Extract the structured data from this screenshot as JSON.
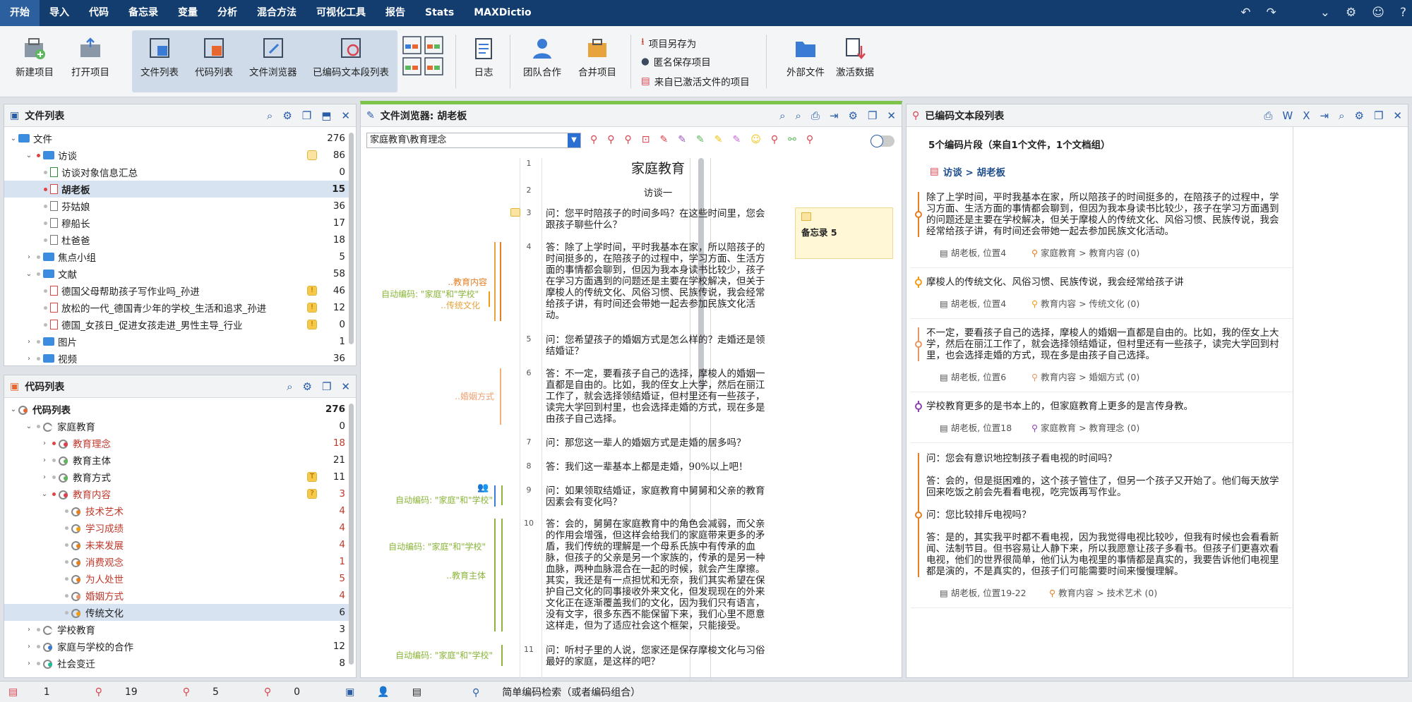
{
  "menu": [
    "开始",
    "导入",
    "代码",
    "备忘录",
    "变量",
    "分析",
    "混合方法",
    "可视化工具",
    "报告",
    "Stats",
    "MAXDictio"
  ],
  "ribbon": {
    "new_project": "新建项目",
    "open_project": "打开项目",
    "doc_list": "文件列表",
    "code_list": "代码列表",
    "doc_browser": "文件浏览器",
    "retrieved_segments": "已编码文本段列表",
    "logbook": "日志",
    "teamwork": "团队合作",
    "merge_projects": "合并项目",
    "save_as": "项目另存为",
    "save_anon": "匿名保存项目",
    "from_activated": "来自已激活文件的项目",
    "external_files": "外部文件",
    "activate_data": "激活数据"
  },
  "doc_panel": {
    "title": "文件列表",
    "rows": [
      {
        "label": "文件",
        "count": "276"
      },
      {
        "label": "访谈",
        "count": "86"
      },
      {
        "label": "访谈对象信息汇总",
        "count": "0"
      },
      {
        "label": "胡老板",
        "count": "15"
      },
      {
        "label": "芬姑娘",
        "count": "36"
      },
      {
        "label": "穆船长",
        "count": "17"
      },
      {
        "label": "杜爸爸",
        "count": "18"
      },
      {
        "label": "焦点小组",
        "count": "5"
      },
      {
        "label": "文献",
        "count": "58"
      },
      {
        "label": "德国父母帮助孩子写作业吗_孙进",
        "count": "46"
      },
      {
        "label": "放松的一代_德国青少年的学校_生活和追求_孙进",
        "count": "12"
      },
      {
        "label": "德国_女孩日_促进女孩走进_男性主导_行业",
        "count": "0"
      },
      {
        "label": "图片",
        "count": "1"
      },
      {
        "label": "视频",
        "count": "36"
      }
    ]
  },
  "code_panel": {
    "title": "代码列表",
    "rows": [
      {
        "label": "代码列表",
        "count": "276"
      },
      {
        "label": "家庭教育",
        "count": "0"
      },
      {
        "label": "教育理念",
        "count": "18"
      },
      {
        "label": "教育主体",
        "count": "21"
      },
      {
        "label": "教育方式",
        "count": "11"
      },
      {
        "label": "教育内容",
        "count": "3"
      },
      {
        "label": "技术艺术",
        "count": "4"
      },
      {
        "label": "学习成绩",
        "count": "4"
      },
      {
        "label": "未来发展",
        "count": "4"
      },
      {
        "label": "消费观念",
        "count": "1"
      },
      {
        "label": "为人处世",
        "count": "5"
      },
      {
        "label": "婚姻方式",
        "count": "4"
      },
      {
        "label": "传统文化",
        "count": "6"
      },
      {
        "label": "学校教育",
        "count": "3"
      },
      {
        "label": "家庭与学校的合作",
        "count": "12"
      },
      {
        "label": "社会变迁",
        "count": "8"
      }
    ]
  },
  "browser": {
    "title": "文件浏览器: 胡老板",
    "code_select": "家庭教育\\教育理念",
    "doc_title": "家庭教育",
    "subtitle": "访谈一",
    "memo": "备忘录 5",
    "paras": [
      {
        "n": "1"
      },
      {
        "n": "2"
      },
      {
        "n": "3",
        "lines": [
          "问：您平时陪孩子的时间多吗？在这些时间里，您会",
          "跟孩子聊些什么？"
        ]
      },
      {
        "n": "4",
        "lines": [
          "答：除了上学时间，平时我基本在家，所以陪孩子的",
          "时间挺多的，在陪孩子的过程中，学习方面、生活方",
          "面的事情都会聊到，但因为我本身读书比较少，孩子",
          "在学习方面遇到的问题还是主要在学校解决，但关于",
          "摩梭人的传统文化、风俗习惯、民族传说，我会经常",
          "给孩子讲，有时间还会带她一起去参加民族文化活",
          "动。"
        ]
      },
      {
        "n": "5",
        "lines": [
          "问：您希望孩子的婚姻方式是怎么样的？走婚还是领",
          "结婚证？"
        ]
      },
      {
        "n": "6",
        "lines": [
          "答：不一定，要看孩子自己的选择，摩梭人的婚姻一",
          "直都是自由的。比如，我的侄女上大学，然后在丽江",
          "工作了，就会选择领结婚证，但村里还有一些孩子，",
          "读完大学回到村里，也会选择走婚的方式，现在多是",
          "由孩子自己选择。"
        ]
      },
      {
        "n": "7",
        "lines": [
          "问：那您这一辈人的婚姻方式是走婚的居多吗？"
        ]
      },
      {
        "n": "8",
        "lines": [
          "答：我们这一辈基本上都是走婚，90%以上吧！"
        ]
      },
      {
        "n": "9",
        "lines": [
          "问：如果领取结婚证，家庭教育中舅舅和父亲的教育",
          "因素会有变化吗？"
        ]
      },
      {
        "n": "10",
        "lines": [
          "答：会的，舅舅在家庭教育中的角色会减弱，而父亲",
          "的作用会增强，但这样会给我们的家庭带来更多的矛",
          "盾，我们传统的理解是一个母系氏族中有传承的血",
          "脉，但孩子的父亲是另一个家族的，传承的是另一种",
          "血脉，两种血脉混合在一起的时候，就会产生摩擦。",
          "其实，我还是有一点担忧和无奈，我们其实希望在保",
          "护自己文化的同事接收外来文化，但发现现在的外来",
          "文化正在逐渐覆盖我们的文化，因为我们只有语言，",
          "没有文字，很多东西不能保留下来，我们心里不愿意",
          "这样走，但为了适应社会这个框架，只能接受。"
        ]
      },
      {
        "n": "11",
        "lines": [
          "问：听村子里的人说，您家还是保存摩梭文化与习俗",
          "最好的家庭，是这样的吧？"
        ]
      }
    ],
    "code_labels": {
      "jyn": "..教育内容",
      "auto1": "自动编码: \"家庭\"和\"学校\"",
      "ctwh": "..传统文化",
      "hyfs": "..婚姻方式",
      "auto2": "自动编码: \"家庭\"和\"学校\"",
      "auto3": "自动编码: \"家庭\"和\"学校\"",
      "jyzt": "..教育主体",
      "auto4": "自动编码: \"家庭\"和\"学校\""
    }
  },
  "segments": {
    "title": "已编码文本段列表",
    "summary": "5个编码片段（来自1个文件，1个文档组）",
    "group": "访谈 > 胡老板",
    "items": [
      {
        "lines": [
          "除了上学时间，平时我基本在家，所以陪孩子的时间挺多的，在陪孩子的过程中，学",
          "习方面、生活方面的事情都会聊到，但因为我本身读书比较少，孩子在学习方面遇到",
          "的问题还是主要在学校解决，但关于摩梭人的传统文化、风俗习惯、民族传说，我会",
          "经常给孩子讲，有时间还会带她一起去参加民族文化活动。"
        ],
        "src": "胡老板, 位置4",
        "code": "家庭教育 > 教育内容 (0)",
        "color": "#e67e22"
      },
      {
        "lines": [
          "摩梭人的传统文化、风俗习惯、民族传说，我会经常给孩子讲"
        ],
        "src": "胡老板, 位置4",
        "code": "教育内容 > 传统文化 (0)",
        "color": "#f39c12"
      },
      {
        "lines": [
          "不一定，要看孩子自己的选择，摩梭人的婚姻一直都是自由的。比如，我的侄女上大",
          "学，然后在丽江工作了，就会选择领结婚证，但村里还有一些孩子，读完大学回到村",
          "里，也会选择走婚的方式，现在多是由孩子自己选择。"
        ],
        "src": "胡老板, 位置6",
        "code": "教育内容 > 婚姻方式 (0)",
        "color": "#e59866"
      },
      {
        "lines": [
          "学校教育更多的是书本上的，但家庭教育上更多的是言传身教。"
        ],
        "src": "胡老板, 位置18",
        "code": "家庭教育 > 教育理念 (0)",
        "color": "#8e44ad"
      },
      {
        "lines": [
          "问：您会有意识地控制孩子看电视的时间吗？",
          "",
          "答：会的，但是挺困难的，这个孩子管住了，但另一个孩子又开始了。他们每天放学",
          "回来吃饭之前会先看看电视，吃完饭再写作业。",
          "",
          "问：您比较排斥电视吗？",
          "",
          "答：是的，其实我平时都不看电视，因为我觉得电视比较吵，但我有时候也会看看新",
          "闻、法制节目。但书容易让人静下来，所以我愿意让孩子多看书。但孩子们更喜欢看",
          "电视，他们的世界很简单，他们认为电视里的事情都是真实的，我要告诉他们电视里",
          "都是演的，不是真实的，但孩子们可能需要时间来慢慢理解。"
        ],
        "src": "胡老板, 位置19-22",
        "code": "教育内容 > 技术艺术 (0)",
        "color": "#e67e22"
      }
    ]
  },
  "status": {
    "docs": "1",
    "codes": "19",
    "seg": "5",
    "memos": "0",
    "search": "简单编码检索（或者编码组合）"
  }
}
